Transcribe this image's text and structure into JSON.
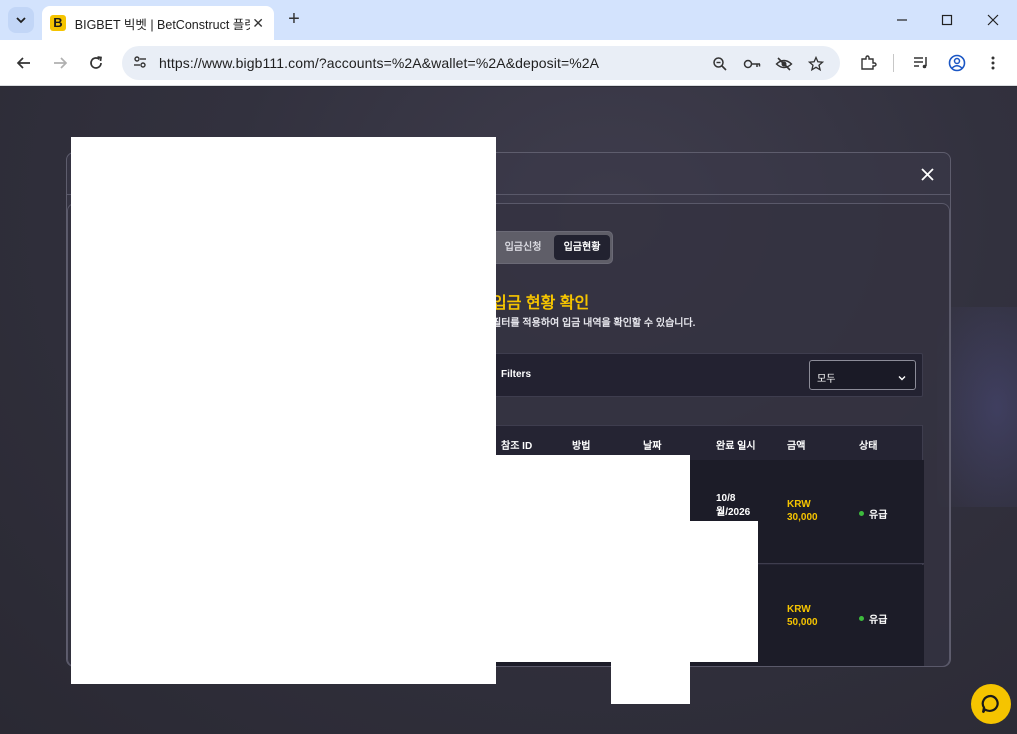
{
  "browser": {
    "tab_title": "BIGBET 빅벳 | BetConstruct 플랫폼",
    "favicon_letter": "B",
    "url": "https://www.bigb111.com/?accounts=%2A&wallet=%2A&deposit=%2A",
    "icons": {
      "tab_search": "chevron-down-icon",
      "new_tab": "plus-icon",
      "minimize": "minimize-icon",
      "maximize": "maximize-icon",
      "close": "close-icon",
      "back": "arrow-left-icon",
      "forward": "arrow-right-icon",
      "reload": "reload-icon",
      "site_info": "tune-icon",
      "zoom": "zoom-out-icon",
      "password": "key-icon",
      "tracking": "eye-off-icon",
      "bookmark": "star-icon",
      "extensions": "puzzle-icon",
      "media": "media-control-icon",
      "profile": "account-icon",
      "menu": "more-vert-icon"
    }
  },
  "modal": {
    "segment": {
      "items": [
        "입금신청",
        "입금현황"
      ],
      "active_index": 1
    },
    "title": "입금 현황 확인",
    "subtitle": "필터를 적용하여 입금 내역을 확인할 수 있습니다.",
    "filters": {
      "label": "Filters",
      "select_value": "모두"
    },
    "table": {
      "headers": [
        "참조 ID",
        "방법",
        "날짜",
        "완료 일시",
        "금액",
        "상태"
      ],
      "rows": [
        {
          "completed_line1": "10/8",
          "completed_line2": "월/2026",
          "currency": "KRW",
          "amount": "30,000",
          "status": "유급"
        },
        {
          "completed_line1": "",
          "completed_line2": "",
          "currency": "KRW",
          "amount": "50,000",
          "status": "유급"
        }
      ]
    }
  },
  "colors": {
    "accent": "#f5c400",
    "status_paid": "#3dbb3d",
    "background": "#2b2b35",
    "table_row": "#1c1c28"
  }
}
